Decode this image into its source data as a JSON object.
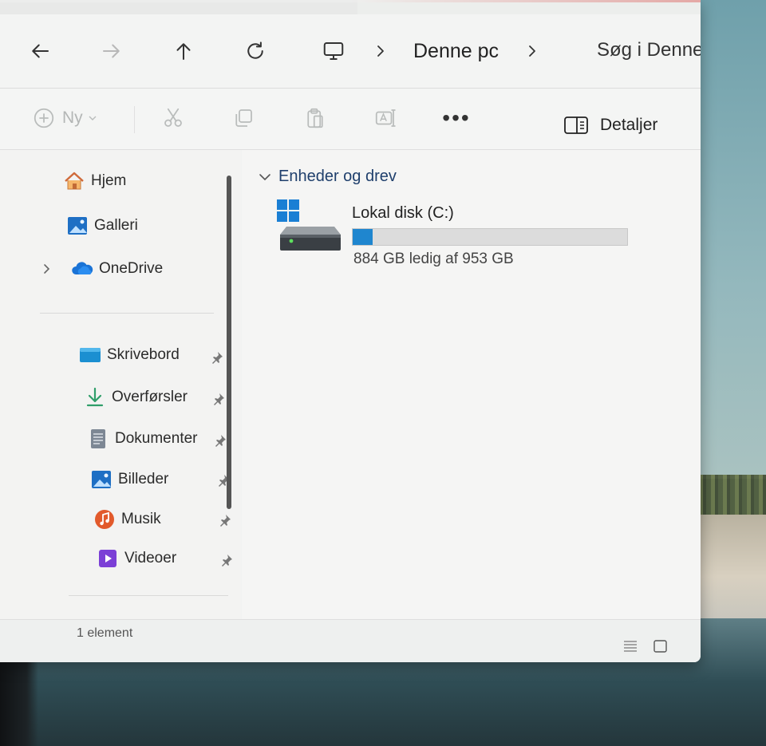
{
  "breadcrumb": {
    "location": "Denne pc"
  },
  "search": {
    "placeholder": "Søg i Denne pc"
  },
  "commandbar": {
    "new_label": "Ny",
    "details_label": "Detaljer",
    "more_label": "•••"
  },
  "sidebar": {
    "top_items": [
      {
        "label": "Hjem",
        "icon": "home-icon"
      },
      {
        "label": "Galleri",
        "icon": "gallery-icon"
      },
      {
        "label": "OneDrive",
        "icon": "onedrive-icon"
      }
    ],
    "pinned_items": [
      {
        "label": "Skrivebord",
        "icon": "desktop-folder-icon"
      },
      {
        "label": "Overførsler",
        "icon": "downloads-icon"
      },
      {
        "label": "Dokumenter",
        "icon": "documents-icon"
      },
      {
        "label": "Billeder",
        "icon": "pictures-icon"
      },
      {
        "label": "Musik",
        "icon": "music-icon"
      },
      {
        "label": "Videoer",
        "icon": "videos-icon"
      }
    ]
  },
  "content": {
    "group_title": "Enheder og drev",
    "drive": {
      "name": "Lokal disk (C:)",
      "free_text": "884 GB ledig af 953 GB",
      "used_fraction": 0.072
    }
  },
  "status": {
    "count": "1 element"
  },
  "colors": {
    "accent": "#1f86cf",
    "group_title": "#1f3f6c"
  }
}
